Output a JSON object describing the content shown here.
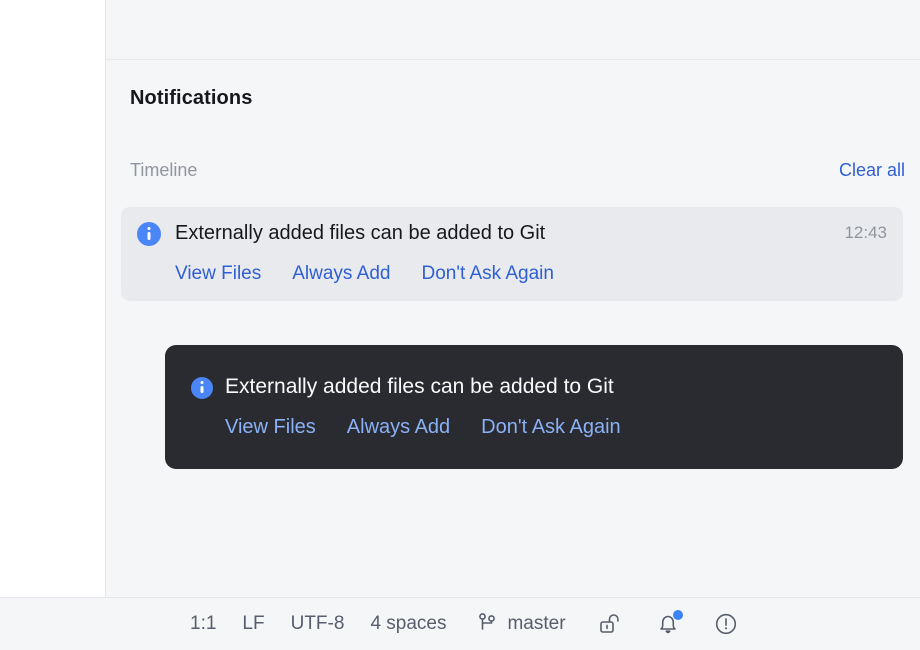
{
  "panel": {
    "title": "Notifications",
    "timeline_label": "Timeline",
    "clear_all_label": "Clear all"
  },
  "notification": {
    "icon": "info-icon",
    "title": "Externally added files can be added to Git",
    "time": "12:43",
    "actions": [
      {
        "label": "View Files"
      },
      {
        "label": "Always Add"
      },
      {
        "label": "Don't Ask Again"
      }
    ]
  },
  "toast": {
    "icon": "info-icon",
    "title": "Externally added files can be added to Git",
    "actions": [
      {
        "label": "View Files"
      },
      {
        "label": "Always Add"
      },
      {
        "label": "Don't Ask Again"
      }
    ]
  },
  "status_bar": {
    "caret_position": "1:1",
    "line_separator": "LF",
    "encoding": "UTF-8",
    "indent": "4 spaces",
    "branch": "master",
    "lock_icon": "unlocked-padlock-icon",
    "notifications_icon": "bell-icon",
    "problems_icon": "exclamation-circle-icon"
  },
  "colors": {
    "link": "#2f5fd6",
    "toast_link": "#8ab0f5",
    "info_blue": "#4a86f7",
    "badge_blue": "#3b82f6",
    "panel_bg": "#f5f6f8",
    "card_bg": "#e9eaee",
    "toast_bg": "#292b30"
  }
}
